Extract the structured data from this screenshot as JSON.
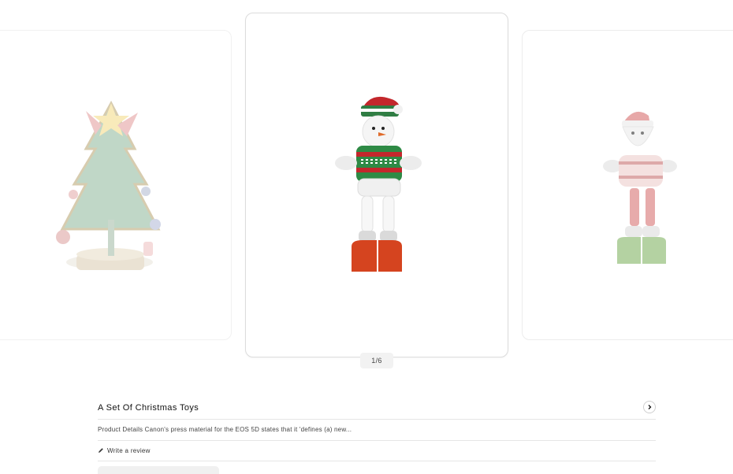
{
  "carousel": {
    "counter": "1/6",
    "slides": [
      {
        "name": "christmas-tree-image"
      },
      {
        "name": "snowman-image"
      },
      {
        "name": "santa-image"
      }
    ]
  },
  "product": {
    "title": "A Set Of Christmas Toys",
    "description": "Product Details Canon's press material for the EOS 5D states that it 'defines (a) new...",
    "review_label": "Write a review",
    "icons": {
      "next": "chevron-right-icon",
      "review": "pencil-icon"
    }
  },
  "colors": {
    "border": "#e6e6e6",
    "text": "#222222",
    "counter_bg": "#f2f2f2"
  }
}
